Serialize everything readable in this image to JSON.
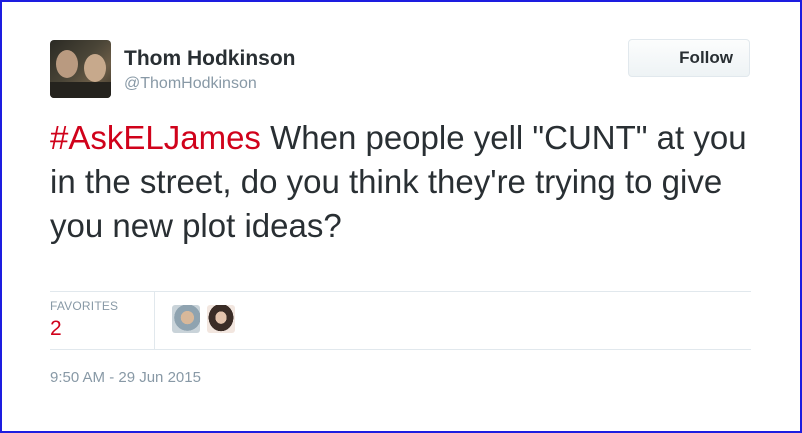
{
  "user": {
    "name": "Thom Hodkinson",
    "handle": "@ThomHodkinson"
  },
  "follow_button": {
    "label": "Follow"
  },
  "tweet": {
    "hashtag": "#AskELJames",
    "text": " When people yell \"CUNT\" at you in the street, do you think they're trying to give you new plot ideas?"
  },
  "stats": {
    "favorites_label": "FAVORITES",
    "favorites_count": "2"
  },
  "timestamp": "9:50 AM - 29 Jun 2015",
  "colors": {
    "hashtag": "#d0021b",
    "text": "#292f33",
    "muted": "#8899a6",
    "border": "#e1e8ed",
    "frame": "#1d1de0"
  }
}
